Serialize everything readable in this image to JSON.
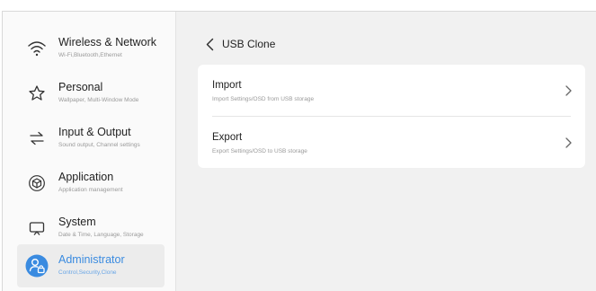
{
  "sidebar": {
    "items": [
      {
        "label": "Wireless & Network",
        "sub": "Wi-Fi,Bluetooth,Ethernet",
        "icon": "wifi-icon"
      },
      {
        "label": "Personal",
        "sub": "Wallpaper, Multi-Window Mode",
        "icon": "star-icon"
      },
      {
        "label": "Input & Output",
        "sub": "Sound output, Channel settings",
        "icon": "swap-arrows-icon"
      },
      {
        "label": "Application",
        "sub": "Application management",
        "icon": "cube-icon"
      },
      {
        "label": "System",
        "sub": "Date & Time, Language, Storage",
        "icon": "monitor-icon"
      },
      {
        "label": "Administrator",
        "sub": "Control,Security,Clone",
        "icon": "admin-lock-icon"
      }
    ],
    "active_index": 5
  },
  "header": {
    "title": "USB Clone"
  },
  "main": {
    "rows": [
      {
        "label": "Import",
        "sub": "Import Settings/OSD from USB storage"
      },
      {
        "label": "Export",
        "sub": "Export Settings/OSD to USB storage"
      }
    ]
  },
  "colors": {
    "accent": "#3a8be0",
    "active_bg": "#ececec",
    "card_bg": "#ffffff",
    "page_bg": "#f1f1f1"
  }
}
